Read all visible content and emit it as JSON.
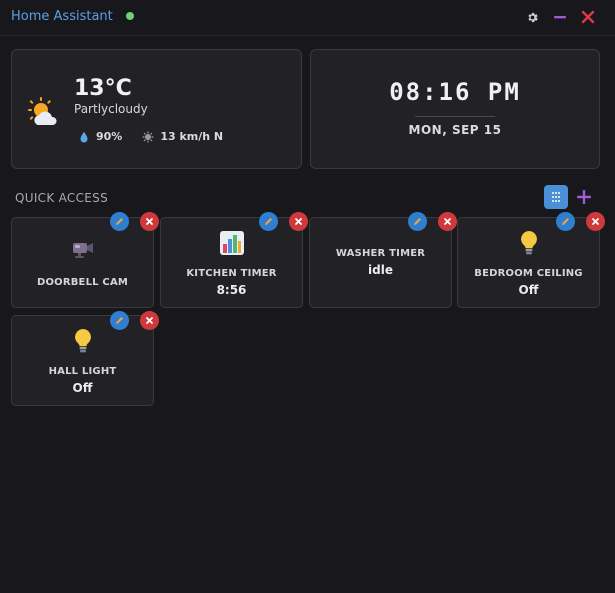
{
  "window": {
    "title": "Home Assistant",
    "status_color": "#6ecf7a",
    "controls": [
      "gear-icon",
      "minimize-icon",
      "close-icon"
    ]
  },
  "weather": {
    "temperature": "13°C",
    "condition": "Partlycloudy",
    "humidity": "90%",
    "wind": "13 km/h N",
    "icon": "partly-cloudy-icon"
  },
  "clock": {
    "time": "08:16 PM",
    "date": "MON, SEP 15"
  },
  "quick_access": {
    "label": "QUICK ACCESS",
    "tiles": [
      {
        "label": "DOORBELL CAM",
        "value": "",
        "icon": "camera-icon"
      },
      {
        "label": "KITCHEN TIMER",
        "value": "8:56",
        "icon": "chart-icon"
      },
      {
        "label": "WASHER TIMER",
        "value": "idle",
        "icon": ""
      },
      {
        "label": "BEDROOM CEILING",
        "value": "Off",
        "icon": "lightbulb-icon"
      },
      {
        "label": "HALL LIGHT",
        "value": "Off",
        "icon": "lightbulb-icon"
      }
    ]
  },
  "colors": {
    "accent": "#5aa0e6",
    "edit_badge": "#2f7fd1",
    "delete_badge": "#d0393b",
    "add": "#9a5fd8"
  }
}
